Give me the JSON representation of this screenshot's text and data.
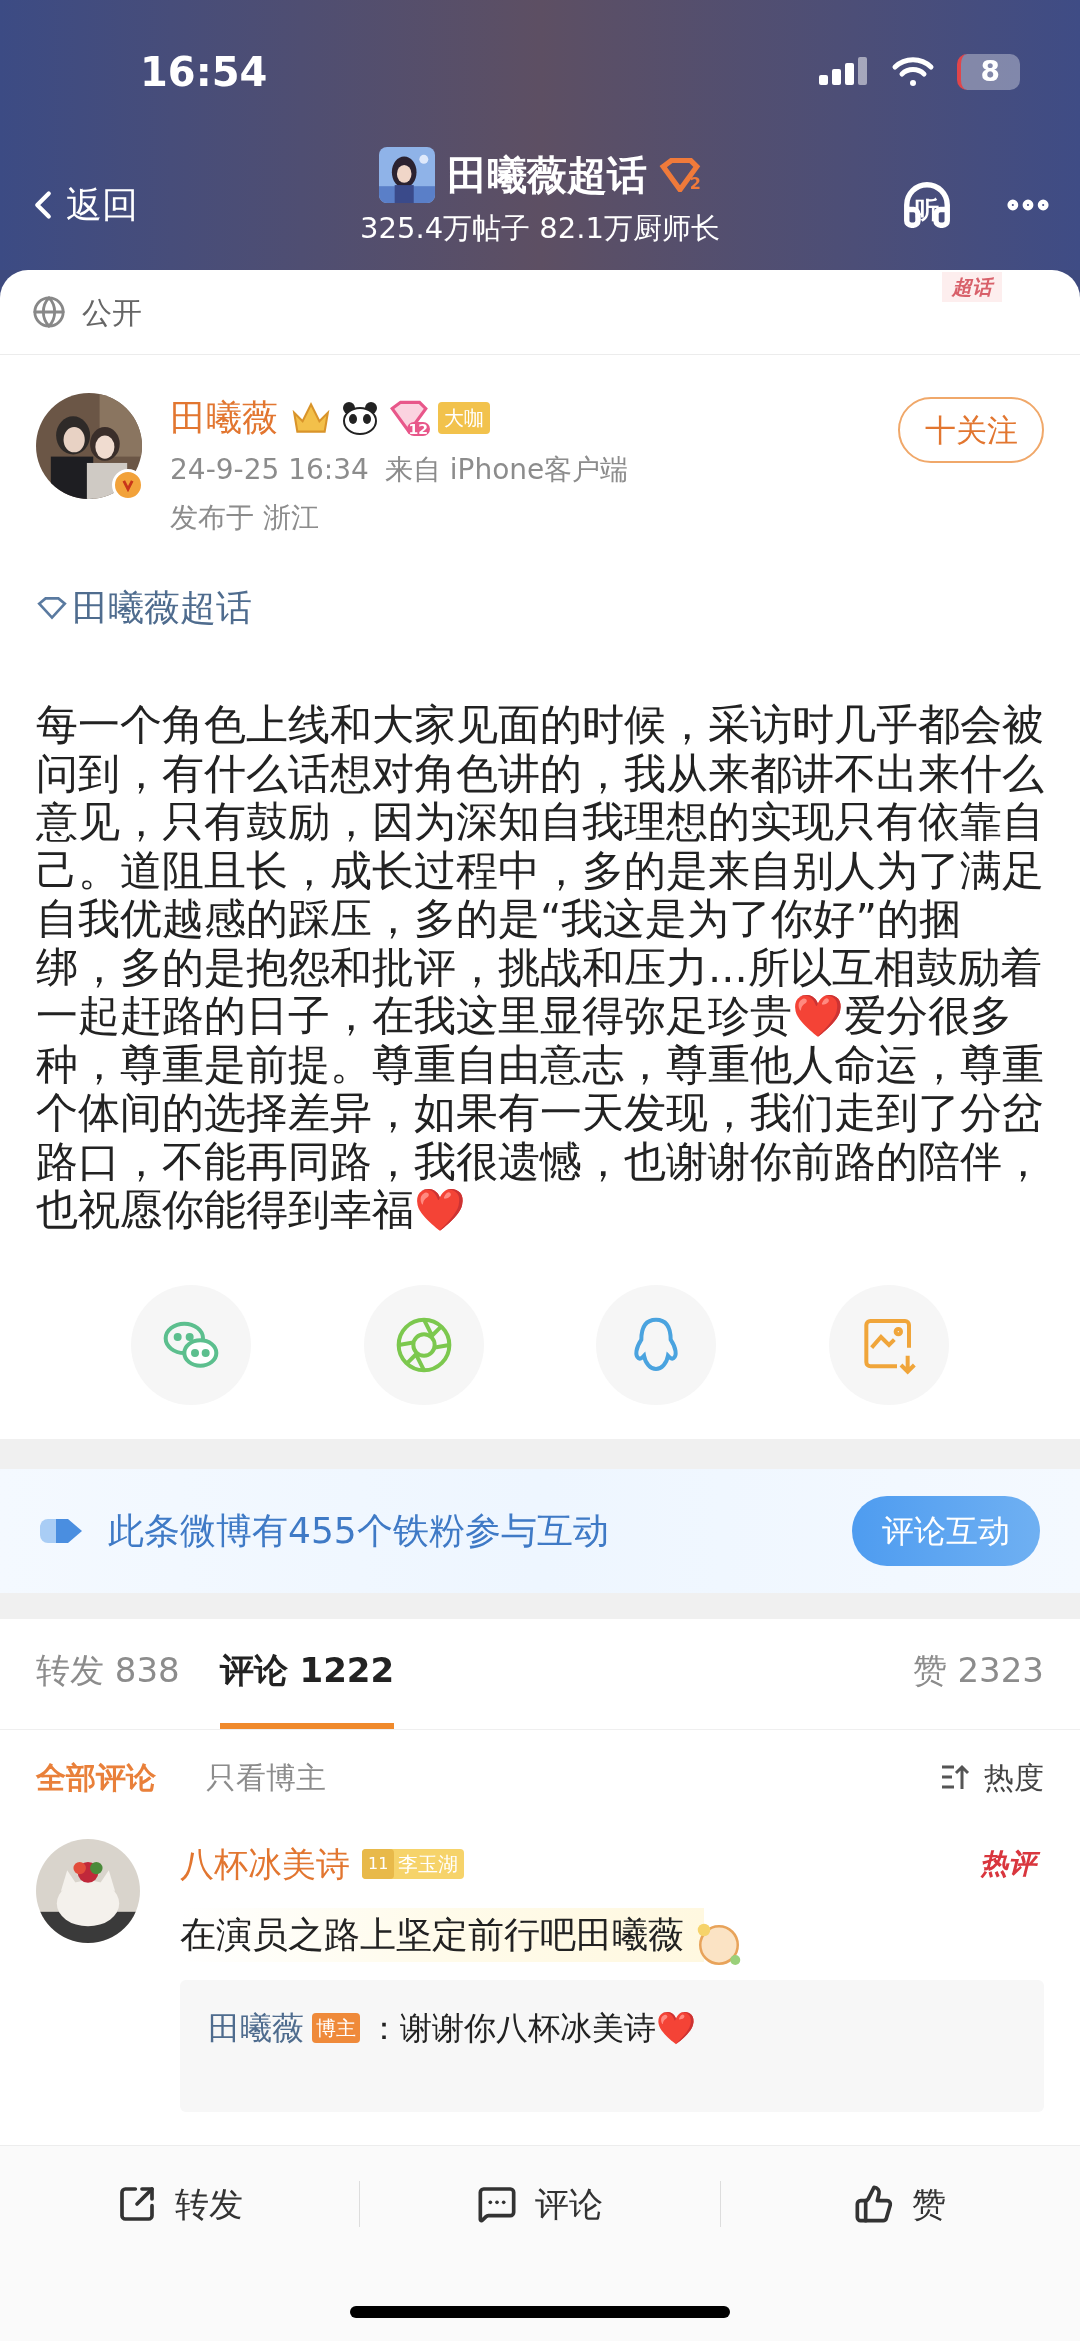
{
  "status_bar": {
    "time": "16:54",
    "battery": "8"
  },
  "nav": {
    "back": "返回",
    "title": "田曦薇超话",
    "title_badge": "2",
    "stats": "325.4万帖子 82.1万厨师长",
    "listen": "听"
  },
  "post": {
    "corner_tag": "超话",
    "visibility": "公开",
    "author": {
      "name": "田曦薇",
      "level": "12",
      "tag": "大咖",
      "time": "24-9-25 16:34",
      "source": "来自 iPhone客户端",
      "location": "发布于 浙江",
      "follow": "十关注"
    },
    "topic": "田曦薇超话",
    "body": "每一个角色上线和大家见面的时候，采访时几乎都会被问到，有什么话想对角色讲的，我从来都讲不出来什么意见，只有鼓励，因为深知自我理想的实现只有依靠自己。道阻且长，成长过程中，多的是来自别人为了满足自我优越感的踩压，多的是“我这是为了你好”的捆绑，多的是抱怨和批评，挑战和压力...所以互相鼓励着一起赶路的日子，在我这里显得弥足珍贵❤️爱分很多种，尊重是前提。尊重自由意志，尊重他人命运，尊重个体间的选择差异，如果有一天发现，我们走到了分岔路口，不能再同路，我很遗憾，也谢谢你前路的陪伴，也祝愿你能得到幸福❤️",
    "share": [
      {
        "kind": "chat"
      },
      {
        "kind": "aperture"
      },
      {
        "kind": "penguin"
      },
      {
        "kind": "save-image"
      }
    ]
  },
  "fans_banner": {
    "text": "此条微博有455个铁粉参与互动",
    "button": "评论互动"
  },
  "tabs": [
    {
      "label": "转发 838",
      "selected": false
    },
    {
      "label": "评论 1222",
      "selected": true
    }
  ],
  "likes": "赞 2323",
  "filters": [
    {
      "label": "全部评论",
      "selected": true
    },
    {
      "label": "只看博主",
      "selected": false
    }
  ],
  "sort": "热度",
  "comments": [
    {
      "name": "八杯冰美诗",
      "fan_level": "11",
      "fan_tag": "李玉湖",
      "hot": "热评",
      "text": "在演员之路上坚定前行吧田曦薇",
      "reply": {
        "name": "田曦薇",
        "tag": "博主",
        "text": "：谢谢你八杯冰美诗❤️"
      }
    }
  ],
  "actions": [
    {
      "kind": "repost",
      "label": "转发"
    },
    {
      "kind": "comment",
      "label": "评论"
    },
    {
      "kind": "like",
      "label": "赞"
    }
  ]
}
